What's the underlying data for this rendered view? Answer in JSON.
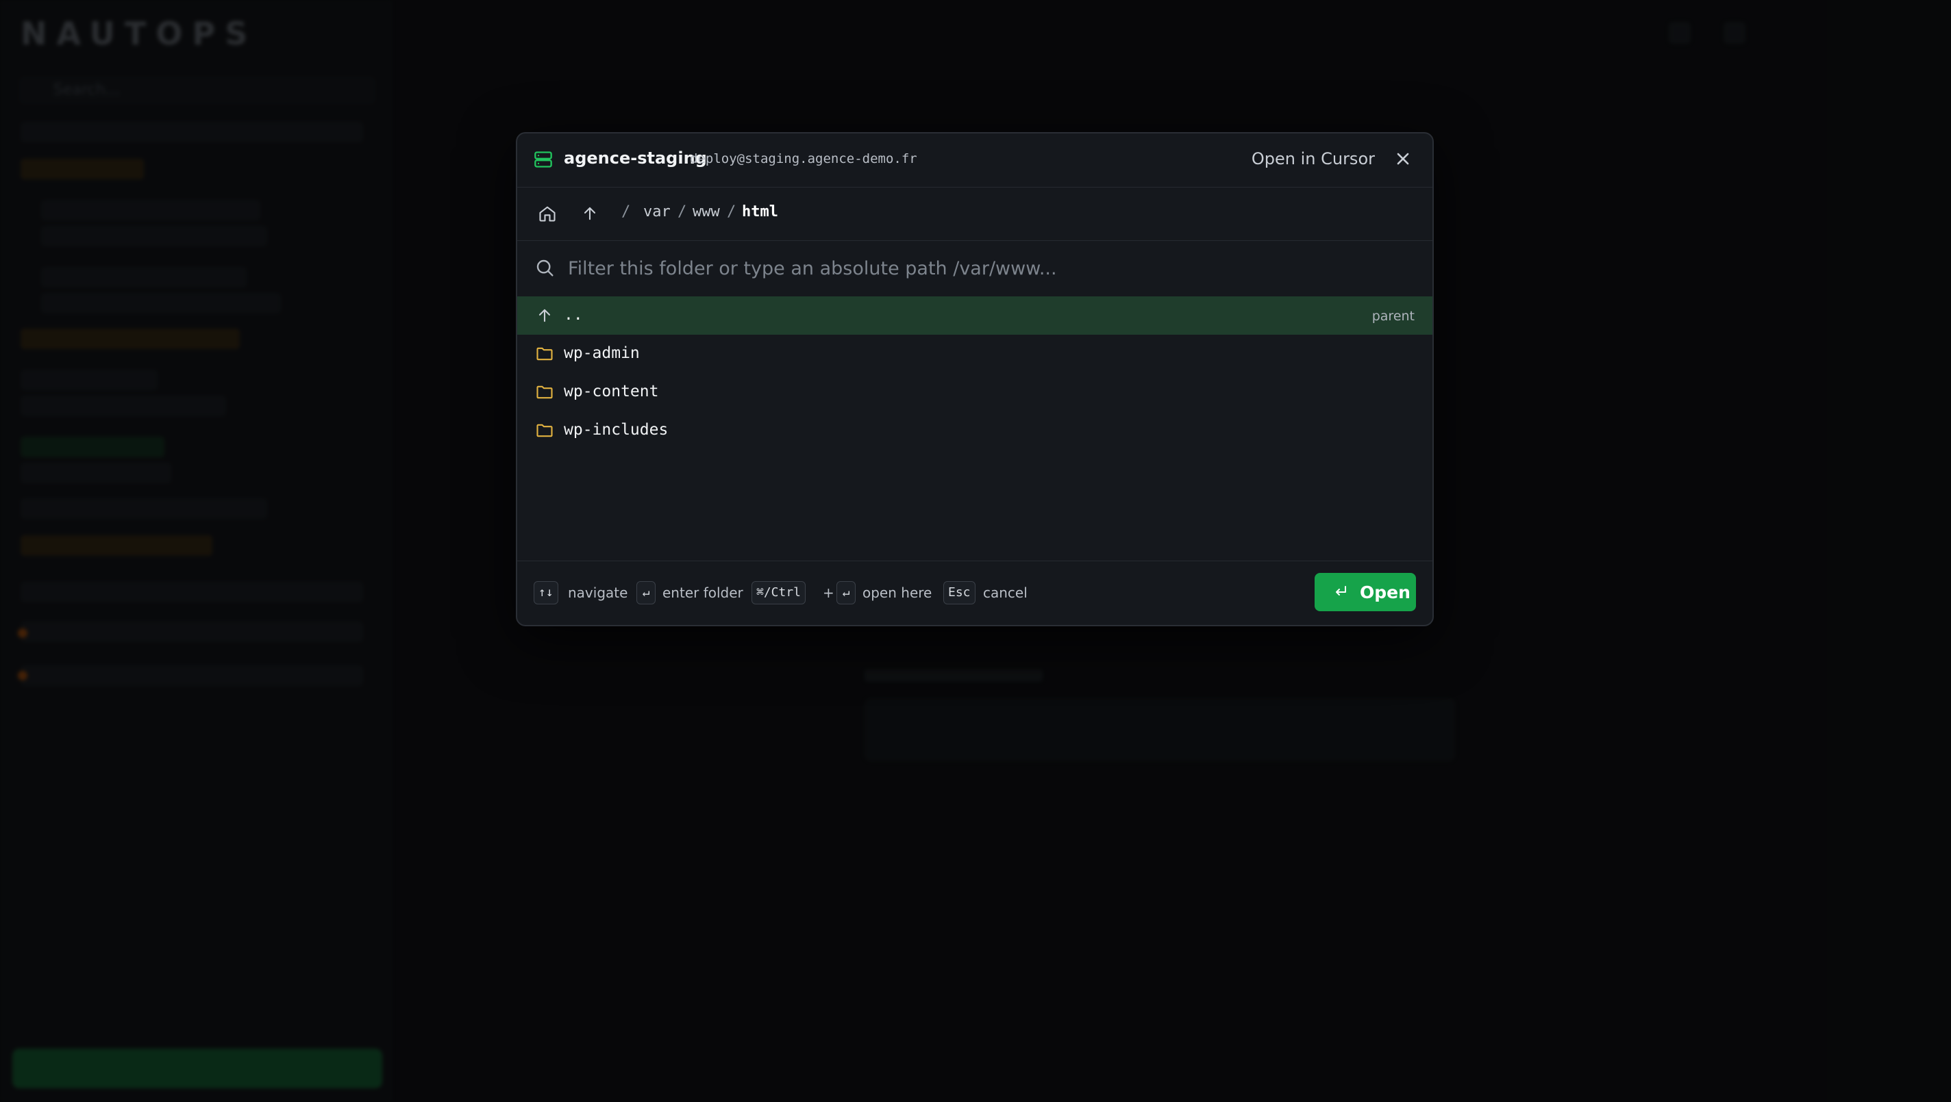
{
  "background": {
    "logo": "NAUTOPS",
    "search_placeholder": "Search..."
  },
  "modal": {
    "host_name": "agence-staging",
    "host_connection": "deploy@staging.agence-demo.fr",
    "open_in_label": "Open in Cursor",
    "breadcrumb": {
      "root_sep": "/",
      "segments": [
        "var",
        "www",
        "html"
      ],
      "separator": "/"
    },
    "filter": {
      "placeholder": "Filter this folder or type an absolute path /var/www...",
      "value": ""
    },
    "entries": [
      {
        "name": "..",
        "kind": "parent",
        "hint": "parent",
        "selected": true
      },
      {
        "name": "wp-admin",
        "kind": "folder"
      },
      {
        "name": "wp-content",
        "kind": "folder"
      },
      {
        "name": "wp-includes",
        "kind": "folder"
      }
    ],
    "footer": {
      "navigate_key": "↑↓",
      "navigate_label": "navigate",
      "enter_key": "↵",
      "enter_label": "enter folder",
      "modifier_key": "⌘/Ctrl",
      "plus": "+",
      "open_here_key": "↵",
      "open_here_label": "open here",
      "cancel_key": "Esc",
      "cancel_label": "cancel",
      "open_button": "Open"
    }
  },
  "colors": {
    "accent": "#16a34a",
    "selected_row": "#1f3d2c",
    "folder_icon": "#e3b341",
    "modal_bg": "#15181d"
  },
  "icons": [
    "server-icon",
    "close-icon",
    "home-icon",
    "arrow-up-icon",
    "search-icon",
    "folder-icon",
    "enter-icon"
  ]
}
